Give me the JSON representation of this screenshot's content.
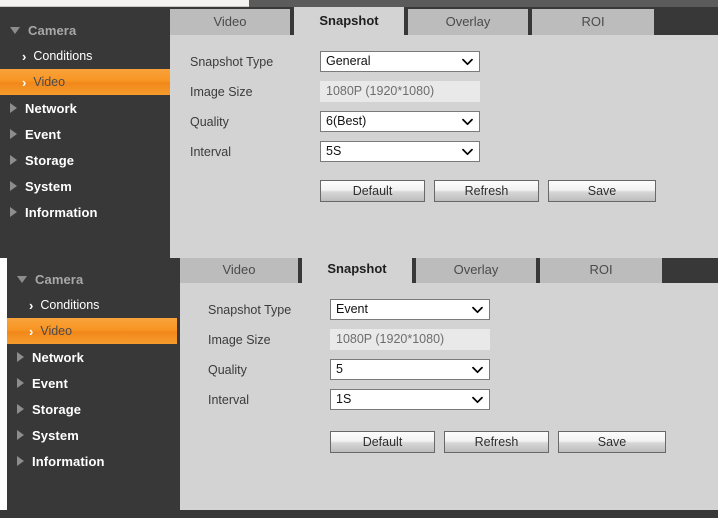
{
  "panels": [
    {
      "id": "panel-general",
      "sidebar": {
        "items": [
          {
            "label": "Camera",
            "level": 0,
            "icon": "triangle-down-icon",
            "state": "expanded",
            "active": false
          },
          {
            "label": "Conditions",
            "level": 1,
            "icon": "chevron-right-icon",
            "state": "collapsed",
            "active": false
          },
          {
            "label": "Video",
            "level": 1,
            "icon": "chevron-right-icon",
            "state": "collapsed",
            "active": true
          },
          {
            "label": "Network",
            "level": 0,
            "icon": "triangle-right-icon",
            "state": "collapsed",
            "active": false
          },
          {
            "label": "Event",
            "level": 0,
            "icon": "triangle-right-icon",
            "state": "collapsed",
            "active": false
          },
          {
            "label": "Storage",
            "level": 0,
            "icon": "triangle-right-icon",
            "state": "collapsed",
            "active": false
          },
          {
            "label": "System",
            "level": 0,
            "icon": "triangle-right-icon",
            "state": "collapsed",
            "active": false
          },
          {
            "label": "Information",
            "level": 0,
            "icon": "triangle-right-icon",
            "state": "collapsed",
            "active": false
          }
        ]
      },
      "tabs": [
        {
          "label": "Video",
          "active": false
        },
        {
          "label": "Snapshot",
          "active": true
        },
        {
          "label": "Overlay",
          "active": false
        },
        {
          "label": "ROI",
          "active": false
        }
      ],
      "form": {
        "fields": [
          {
            "label": "Snapshot Type",
            "type": "select",
            "value": "General"
          },
          {
            "label": "Image Size",
            "type": "readonly",
            "value": "1080P (1920*1080)"
          },
          {
            "label": "Quality",
            "type": "select",
            "value": "6(Best)"
          },
          {
            "label": "Interval",
            "type": "select",
            "value": "5S"
          }
        ],
        "buttons": [
          {
            "label": "Default"
          },
          {
            "label": "Refresh"
          },
          {
            "label": "Save"
          }
        ]
      }
    },
    {
      "id": "panel-event",
      "sidebar": {
        "items": [
          {
            "label": "Camera",
            "level": 0,
            "icon": "triangle-down-icon",
            "state": "expanded",
            "active": false
          },
          {
            "label": "Conditions",
            "level": 1,
            "icon": "chevron-right-icon",
            "state": "collapsed",
            "active": false
          },
          {
            "label": "Video",
            "level": 1,
            "icon": "chevron-right-icon",
            "state": "collapsed",
            "active": true
          },
          {
            "label": "Network",
            "level": 0,
            "icon": "triangle-right-icon",
            "state": "collapsed",
            "active": false
          },
          {
            "label": "Event",
            "level": 0,
            "icon": "triangle-right-icon",
            "state": "collapsed",
            "active": false
          },
          {
            "label": "Storage",
            "level": 0,
            "icon": "triangle-right-icon",
            "state": "collapsed",
            "active": false
          },
          {
            "label": "System",
            "level": 0,
            "icon": "triangle-right-icon",
            "state": "collapsed",
            "active": false
          },
          {
            "label": "Information",
            "level": 0,
            "icon": "triangle-right-icon",
            "state": "collapsed",
            "active": false
          }
        ]
      },
      "tabs": [
        {
          "label": "Video",
          "active": false
        },
        {
          "label": "Snapshot",
          "active": true
        },
        {
          "label": "Overlay",
          "active": false
        },
        {
          "label": "ROI",
          "active": false
        }
      ],
      "form": {
        "fields": [
          {
            "label": "Snapshot Type",
            "type": "select",
            "value": "Event"
          },
          {
            "label": "Image Size",
            "type": "readonly",
            "value": "1080P (1920*1080)"
          },
          {
            "label": "Quality",
            "type": "select",
            "value": "5"
          },
          {
            "label": "Interval",
            "type": "select",
            "value": "1S"
          }
        ],
        "buttons": [
          {
            "label": "Default"
          },
          {
            "label": "Refresh"
          },
          {
            "label": "Save"
          }
        ]
      }
    }
  ],
  "colors": {
    "accent": "#f7941e",
    "sidebar_bg": "#383838",
    "content_bg": "#d3d3d3",
    "tab_inactive": "#bcbcbc",
    "tab_active": "#d3d3d3"
  }
}
